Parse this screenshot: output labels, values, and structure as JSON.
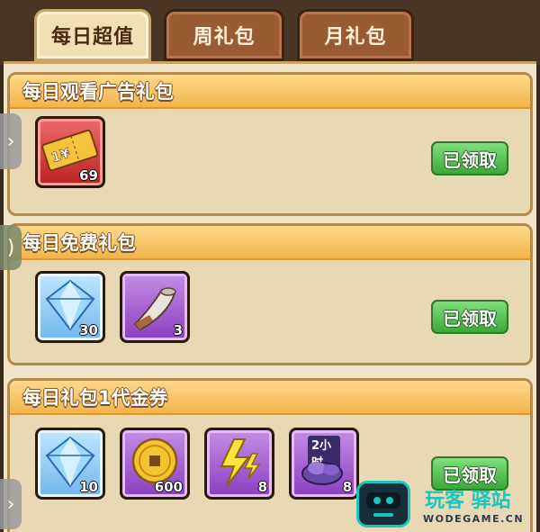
{
  "tabs": [
    {
      "label": "每日超值",
      "active": true
    },
    {
      "label": "周礼包",
      "active": false
    },
    {
      "label": "月礼包",
      "active": false
    }
  ],
  "sections": [
    {
      "title": "每日观看广告礼包",
      "items": [
        {
          "icon": "ticket-icon",
          "qty": "69",
          "rarity": "red"
        }
      ],
      "button": "已领取"
    },
    {
      "title": "每日免费礼包",
      "items": [
        {
          "icon": "diamond-icon",
          "qty": "30",
          "rarity": "blue"
        },
        {
          "icon": "horn-icon",
          "qty": "3",
          "rarity": "purple"
        }
      ],
      "button": "已领取"
    },
    {
      "title": "每日礼包1代金券",
      "items": [
        {
          "icon": "diamond-icon",
          "qty": "10",
          "rarity": "blue"
        },
        {
          "icon": "gold-coin-icon",
          "qty": "600",
          "rarity": "purple"
        },
        {
          "icon": "lightning-icon",
          "qty": "8",
          "rarity": "purple"
        },
        {
          "icon": "purple-ore-icon",
          "qty": "8",
          "rarity": "purple",
          "badge": "2小时"
        }
      ],
      "button": "已领取"
    }
  ],
  "ticket_text": "1¥",
  "watermark": {
    "brand": "玩客 驿站",
    "url": "WODEGAME.CN"
  },
  "colors": {
    "header": "#f2b44a",
    "claim": "#3ca83a",
    "tab_active": "#f3dfb4",
    "tab_inactive": "#9a5a32"
  }
}
